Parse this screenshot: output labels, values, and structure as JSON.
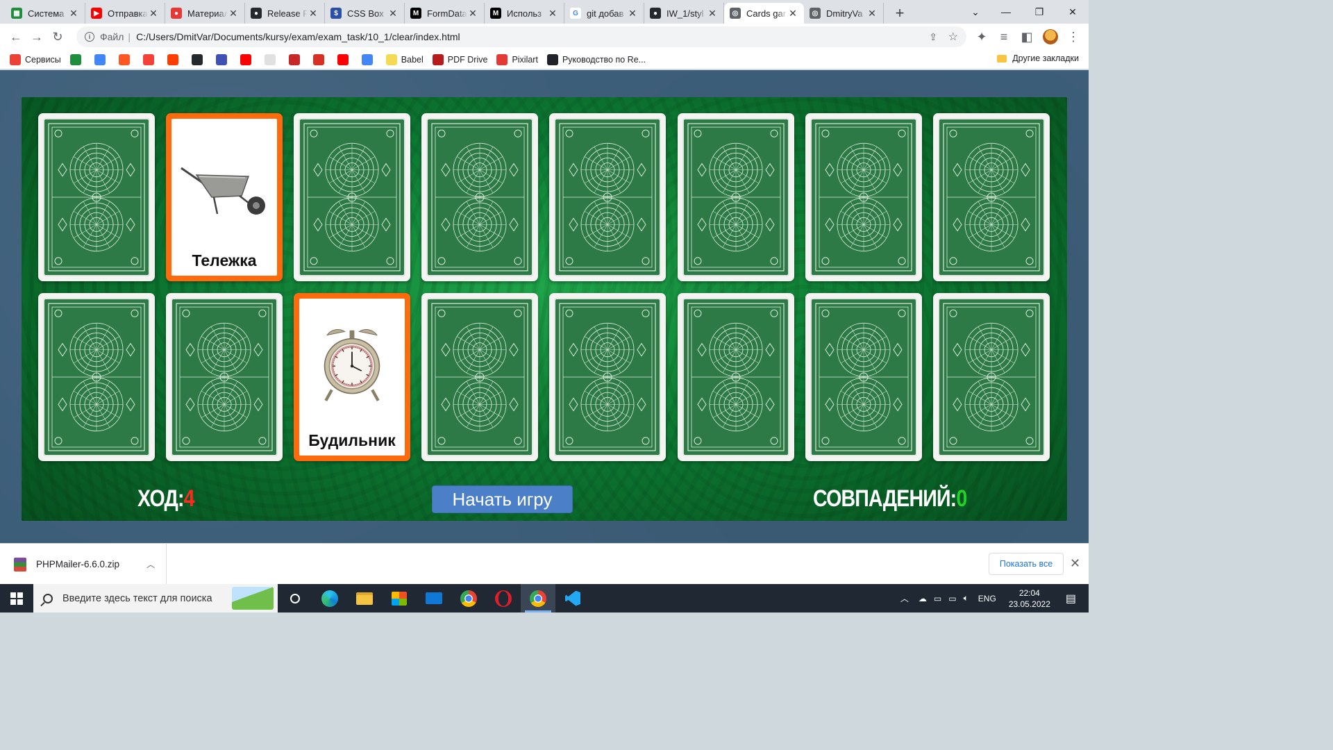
{
  "browser": {
    "tabs": [
      {
        "label": "Система",
        "color": "#1e8e3e",
        "glyph": "▦"
      },
      {
        "label": "Отправка",
        "color": "#ff0000",
        "glyph": "▶"
      },
      {
        "label": "Материал",
        "color": "#e53935",
        "glyph": "●"
      },
      {
        "label": "Release P",
        "color": "#24292e",
        "glyph": "●"
      },
      {
        "label": "CSS Box S",
        "color": "#2a4fa8",
        "glyph": "$"
      },
      {
        "label": "FormData",
        "color": "#000000",
        "glyph": "M"
      },
      {
        "label": "Использ",
        "color": "#000000",
        "glyph": "M"
      },
      {
        "label": "git добав",
        "color": "#ffffff",
        "glyph": "G"
      },
      {
        "label": "IW_1/styl",
        "color": "#24292e",
        "glyph": "●"
      },
      {
        "label": "Cards gar",
        "color": "#5f6368",
        "glyph": "◎",
        "active": true
      },
      {
        "label": "DmitryVa",
        "color": "#5f6368",
        "glyph": "◎"
      }
    ],
    "address": {
      "scheme_label": "Файл",
      "url": "C:/Users/DmitVar/Documents/kursy/exam/exam_task/10_1/clear/index.html"
    },
    "bookmarks": [
      {
        "label": "Сервисы",
        "color": "#ea4335"
      },
      {
        "label": "",
        "color": "#1e8e3e"
      },
      {
        "label": "",
        "color": "#4285f4"
      },
      {
        "label": "",
        "color": "#ff5722"
      },
      {
        "label": "",
        "color": "#f44336"
      },
      {
        "label": "",
        "color": "#ff3d00"
      },
      {
        "label": "",
        "color": "#24292e"
      },
      {
        "label": "",
        "color": "#3f51b5"
      },
      {
        "label": "",
        "color": "#ff0000"
      },
      {
        "label": "",
        "color": "#e0e0e0"
      },
      {
        "label": "",
        "color": "#c62828"
      },
      {
        "label": "",
        "color": "#d93025"
      },
      {
        "label": "",
        "color": "#ff0000"
      },
      {
        "label": "",
        "color": "#4285f4"
      },
      {
        "label": "Babel",
        "color": "#f5da55"
      },
      {
        "label": "PDF Drive",
        "color": "#b71c1c"
      },
      {
        "label": "Pixilart",
        "color": "#e53935"
      },
      {
        "label": "Руководство по Re...",
        "color": "#20232a"
      }
    ],
    "other_bookmarks": "Другие закладки"
  },
  "game": {
    "cards_row1": [
      {
        "open": false
      },
      {
        "open": true,
        "name": "Тележка",
        "image": "wheelbarrow"
      },
      {
        "open": false
      },
      {
        "open": false
      },
      {
        "open": false
      },
      {
        "open": false
      },
      {
        "open": false
      },
      {
        "open": false
      }
    ],
    "cards_row2": [
      {
        "open": false
      },
      {
        "open": false
      },
      {
        "open": true,
        "name": "Будильник",
        "image": "alarm-clock"
      },
      {
        "open": false
      },
      {
        "open": false
      },
      {
        "open": false
      },
      {
        "open": false
      },
      {
        "open": false
      }
    ],
    "moves_label": "ХОД:",
    "moves_value": "4",
    "matches_label": "СОВПАДЕНИЙ:",
    "matches_value": "0",
    "start_button": "Начать игру",
    "colors": {
      "open_border": "#ff6a0d",
      "moves_value": "#ff2a1f",
      "matches_value": "#22d12a",
      "button": "#4b7fc7"
    }
  },
  "downloads": {
    "file": "PHPMailer-6.6.0.zip",
    "show_all": "Показать все"
  },
  "taskbar": {
    "search_placeholder": "Введите здесь текст для поиска",
    "language": "ENG",
    "time": "22:04",
    "date": "23.05.2022"
  }
}
